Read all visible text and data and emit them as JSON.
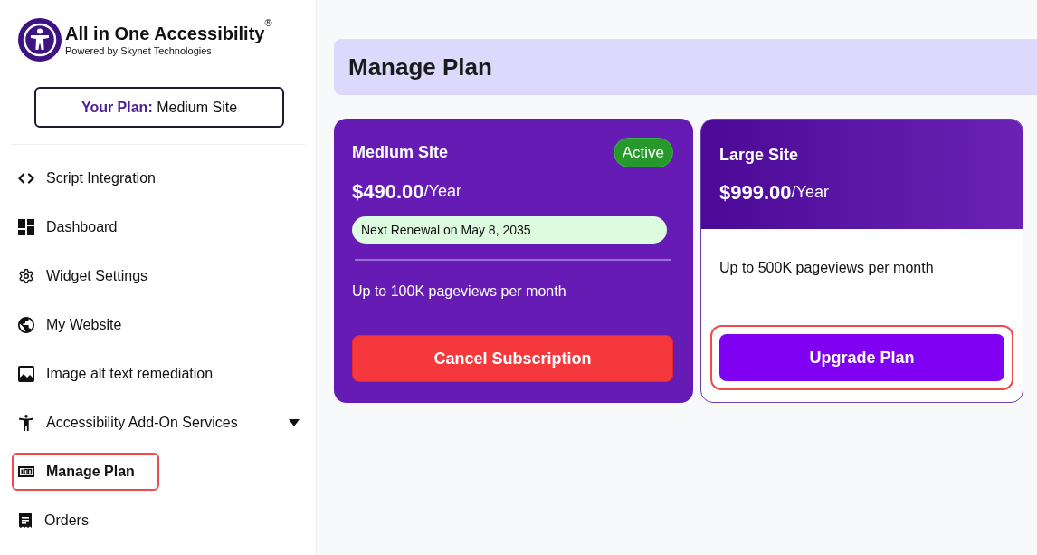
{
  "logo": {
    "title": "All in One Accessibility$^{®}$",
    "subtitle": "Powered by Skynet Technologies"
  },
  "plan_badge": "**Your Plan:** Medium Site",
  "sidebar": {
    "items": [
      {
        "label": "Script Integration",
        "kind": "link",
        "selected": false,
        "highlighted": false
      },
      {
        "label": "Dashboard",
        "kind": "link",
        "selected": false,
        "highlighted": false
      },
      {
        "label": "Widget Settings",
        "kind": "link",
        "selected": false,
        "highlighted": false
      },
      {
        "label": "My Website",
        "kind": "link",
        "selected": false,
        "highlighted": false
      },
      {
        "label": "Image alt text remediation",
        "kind": "link",
        "selected": false,
        "highlighted": false
      },
      {
        "label": "Accessibility Add-On Services",
        "kind": "dropdown",
        "expanded": false,
        "selected": false,
        "highlighted": false
      },
      {
        "label": "Manage Plan",
        "kind": "link",
        "selected": true,
        "highlighted": true
      },
      {
        "label": "Orders",
        "kind": "link",
        "selected": false,
        "highlighted": false
      }
    ]
  },
  "page": {
    "title": "Manage Plan"
  },
  "plans": [
    {
      "kind": "current",
      "name": "Medium Site",
      "status": "Active",
      "price": "**$490.00**/Year",
      "renewal": "Next Renewal on May 8, 2035",
      "feature": "Up to 100K pageviews per month",
      "button": {
        "label": "Cancel Subscription",
        "kind": "danger",
        "highlighted": false
      }
    },
    {
      "kind": "offer",
      "name": "Large Site",
      "price": "**$999.00**/Year",
      "feature": "Up to 500K pageviews per month",
      "button": {
        "label": "Upgrade Plan",
        "kind": "primary",
        "highlighted": true
      }
    }
  ]
}
